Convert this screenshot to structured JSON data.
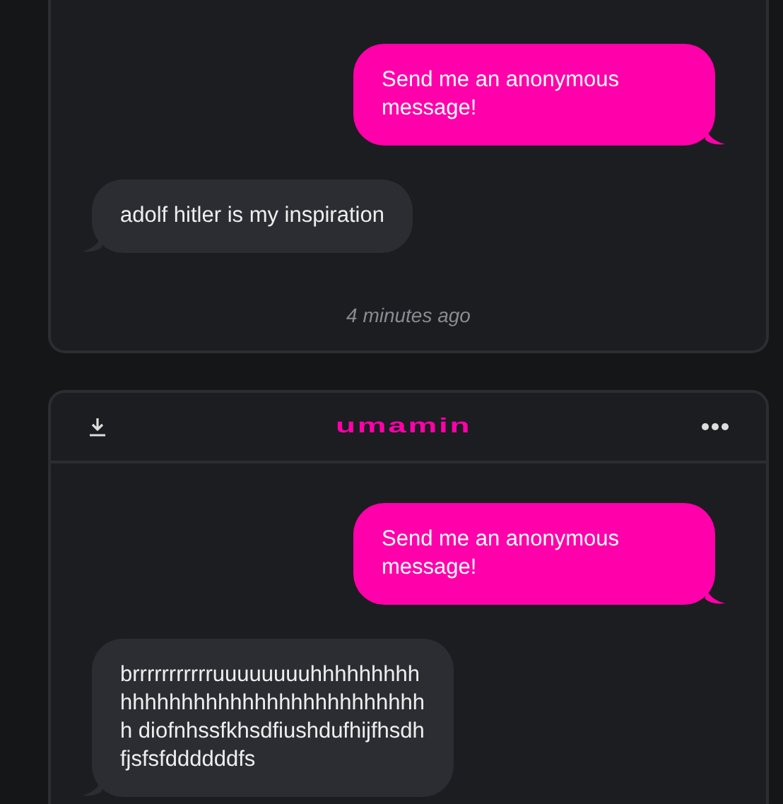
{
  "cards": [
    {
      "messages": [
        {
          "kind": "sent",
          "text": "Send me an anonymous message!"
        },
        {
          "kind": "received",
          "text": "adolf hitler is my inspiration"
        }
      ],
      "time": "4 minutes ago"
    },
    {
      "header": {
        "logo": "umamin"
      },
      "messages": [
        {
          "kind": "sent",
          "text": "Send me an anonymous message!"
        },
        {
          "kind": "received",
          "text": "brrrrrrrrrrruuuuuuuuhhhhhhhhhhhhhhhhhhhhhhhhhhhhhhhhhhh diofnhssfkhsdfiushdufhijfhsdhfjsfsfddddddfs"
        }
      ]
    }
  ]
}
